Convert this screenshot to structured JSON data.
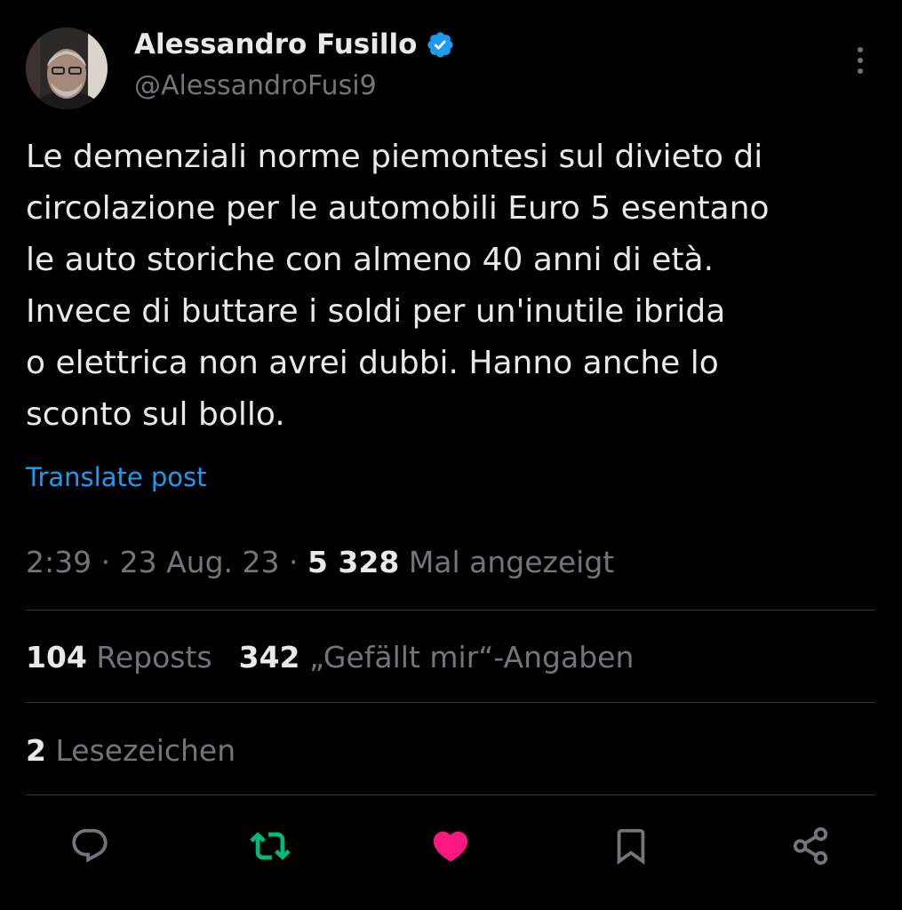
{
  "author": {
    "name": "Alessandro Fusillo",
    "handle": "@AlessandroFusi9",
    "verified": true
  },
  "tweet": {
    "text": "Le demenziali norme piemontesi sul divieto di\ncircolazione per le automobili Euro 5 esentano\nle auto storiche con almeno 40 anni di età.\nInvece di buttare i soldi per un'inutile ibrida\no elettrica non avrei dubbi. Hanno anche lo\nsconto sul bollo.",
    "translate_label": "Translate post"
  },
  "meta": {
    "time": "2:39",
    "separator": " · ",
    "date": "23 Aug. 23",
    "views_count": "5 328",
    "views_label": "Mal angezeigt"
  },
  "stats": {
    "reposts_count": "104",
    "reposts_label": "Reposts",
    "likes_count": "342",
    "likes_label": "„Gefällt mir“-Angaben",
    "bookmarks_count": "2",
    "bookmarks_label": "Lesezeichen"
  },
  "actions": {
    "reply_icon": "reply-icon",
    "repost_icon": "repost-icon",
    "like_icon": "heart-icon",
    "bookmark_icon": "bookmark-icon",
    "share_icon": "share-icon"
  },
  "colors": {
    "background": "#000000",
    "text": "#e7e9ea",
    "secondary": "#71767b",
    "link": "#1d9bf0",
    "repost_active": "#00ba7c",
    "like_active": "#f91880",
    "divider": "#2f3336"
  }
}
